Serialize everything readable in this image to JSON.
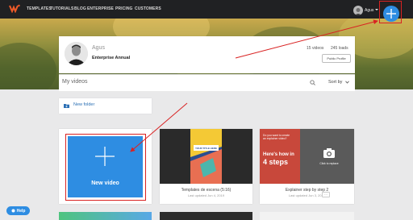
{
  "nav": {
    "links": [
      "TEMPLATES",
      "TUTORIALS",
      "BLOG",
      "ENTERPRISE",
      "PRICING",
      "CUSTOMERS"
    ],
    "username": "Agus"
  },
  "profile": {
    "name": "Agus",
    "plan": "Enterprise  Annual",
    "videos": "15 videos",
    "loads": "245 loads",
    "public_profile_label": "Public Profile"
  },
  "videos_section": {
    "title": "My videos",
    "sort_label": "Sort by"
  },
  "folder": {
    "label": "New folder"
  },
  "new_video": {
    "label": "New video"
  },
  "tiles": [
    {
      "title": "Templates de escena (5:16)",
      "date": "Last updated Jun 4, 2019",
      "thumb_text": "YOUR TITLE HERE"
    },
    {
      "title": "Explainer step by step 2",
      "date": "Last updated Jun 3, 2019",
      "thumb_q": "Do you want to create an explainer video?",
      "thumb_heading1": "Here's how in",
      "thumb_heading2": "4 steps",
      "thumb_replace": "Click to replace",
      "menu": "···"
    }
  ],
  "help": {
    "label": "Help"
  },
  "colors": {
    "accent": "#2e8de2",
    "annotation_red": "#d92222",
    "nav_bg": "#202123"
  }
}
